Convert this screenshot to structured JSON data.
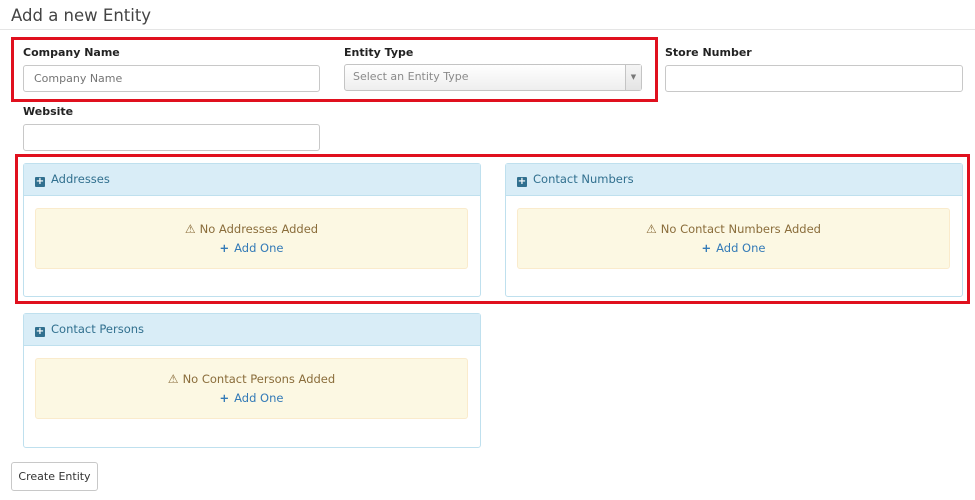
{
  "page": {
    "title": "Add a new Entity"
  },
  "form": {
    "company_name": {
      "label": "Company Name",
      "placeholder": "Company Name"
    },
    "entity_type": {
      "label": "Entity Type",
      "placeholder": "Select an Entity Type"
    },
    "store_number": {
      "label": "Store Number",
      "value": ""
    },
    "website": {
      "label": "Website",
      "value": ""
    }
  },
  "panels": {
    "addresses": {
      "title": "Addresses",
      "empty": "No Addresses Added",
      "add": "Add One"
    },
    "contact_numbers": {
      "title": "Contact Numbers",
      "empty": "No Contact Numbers Added",
      "add": "Add One"
    },
    "contact_persons": {
      "title": "Contact Persons",
      "empty": "No Contact Persons Added",
      "add": "Add One"
    }
  },
  "actions": {
    "create_label": "Create Entity"
  },
  "colors": {
    "highlight": "#e0101e",
    "panel_head": "#d9edf7",
    "alert_bg": "#fcf8e3",
    "link": "#337ab7"
  },
  "icons": [
    "plus-square-icon",
    "warning-icon",
    "plus-icon",
    "dropdown-arrow-icon"
  ]
}
